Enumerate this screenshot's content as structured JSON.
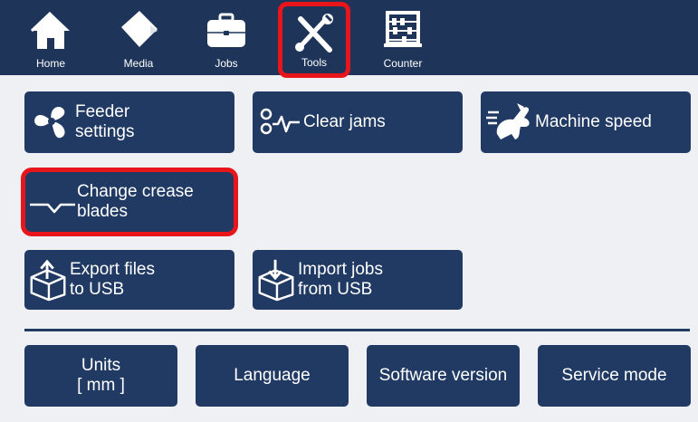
{
  "nav": {
    "tabs": [
      {
        "label": "Home",
        "icon": "home-icon"
      },
      {
        "label": "Media",
        "icon": "media-icon"
      },
      {
        "label": "Jobs",
        "icon": "briefcase-icon"
      },
      {
        "label": "Tools",
        "icon": "tools-icon",
        "highlighted": true
      },
      {
        "label": "Counter",
        "icon": "abacus-icon"
      }
    ]
  },
  "tools": {
    "feeder_settings": "Feeder\nsettings",
    "clear_jams": "Clear jams",
    "machine_speed": "Machine speed",
    "change_crease_blades": "Change crease\nblades",
    "export_files": "Export files\nto USB",
    "import_jobs": "Import jobs\nfrom USB"
  },
  "bottom": {
    "units_label": "Units",
    "units_value": "[ mm ]",
    "language": "Language",
    "software_version": "Software version",
    "service_mode": "Service mode"
  },
  "colors": {
    "bar": "#1e3559",
    "button": "#213a63",
    "highlight": "#e8161b",
    "background": "#eef0f3"
  }
}
